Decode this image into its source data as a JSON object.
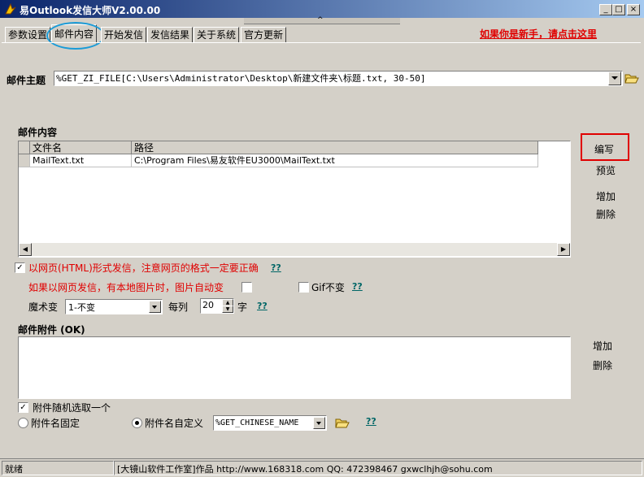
{
  "window": {
    "title": "易Outlook发信大师V2.00.00",
    "minimize": "_",
    "maximize": "□",
    "close": "×"
  },
  "tabs": [
    {
      "label": "参数设置"
    },
    {
      "label": "邮件内容"
    },
    {
      "label": "开始发信"
    },
    {
      "label": "发信结果"
    },
    {
      "label": "关于系统"
    },
    {
      "label": "官方更新"
    }
  ],
  "newbie_link": "如果你是新手，请点击这里",
  "subject": {
    "label": "邮件主题",
    "value": "%GET_ZI_FILE[C:\\Users\\Administrator\\Desktop\\新建文件夹\\标题.txt, 30-50]"
  },
  "content": {
    "label": "邮件内容",
    "columns": [
      "文件名",
      "路径"
    ],
    "rows": [
      {
        "name": "MailText.txt",
        "path": "C:\\Program Files\\易友软件EU3000\\MailText.txt"
      }
    ],
    "buttons": {
      "edit": "编写",
      "preview": "预览",
      "add": "增加",
      "delete": "删除"
    }
  },
  "options": {
    "html_mode": {
      "label": "以网页(HTML)形式发信，注意网页的格式一定要正确",
      "checked": true,
      "help": "??"
    },
    "local_img": {
      "label": "如果以网页发信，有本地图片时，图片自动变",
      "checked": false
    },
    "gif_keep": {
      "label": "Gif不变",
      "checked": false,
      "help": "??"
    },
    "magic": {
      "label": "魔术变",
      "value": "1-不变",
      "per_col_label": "每列",
      "per_col_value": "20",
      "unit": "字",
      "help": "??"
    }
  },
  "attachments": {
    "label": "邮件附件 (OK)",
    "buttons": {
      "add": "增加",
      "delete": "删除"
    },
    "random_pick": {
      "label": "附件随机选取一个",
      "checked": true
    },
    "fixed_name": {
      "label": "附件名固定",
      "selected": false
    },
    "custom_name": {
      "label": "附件名自定义",
      "selected": true,
      "value": "%GET_CHINESE_NAME",
      "help": "??"
    }
  },
  "statusbar": {
    "status": "就绪",
    "credit": "[大镜山软件工作室]作品 http://www.168318.com QQ: 472398467 gxwclhjh@sohu.com"
  }
}
